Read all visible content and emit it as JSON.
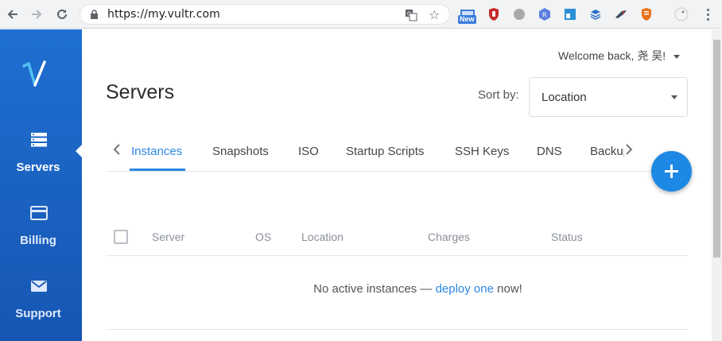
{
  "browser": {
    "url": "https://my.vultr.com",
    "extension_badge": "New",
    "icons": [
      "back-arrow-icon",
      "forward-arrow-icon",
      "reload-icon",
      "lock-icon",
      "translate-icon",
      "star-icon",
      "kebab-menu-icon"
    ]
  },
  "user": {
    "welcome": "Welcome back, 尧 吴!"
  },
  "sidebar": {
    "items": [
      {
        "label": "Servers",
        "icon": "server-stack-icon",
        "active": true
      },
      {
        "label": "Billing",
        "icon": "credit-card-icon",
        "active": false
      },
      {
        "label": "Support",
        "icon": "envelope-icon",
        "active": false
      }
    ]
  },
  "page": {
    "title": "Servers",
    "sort_label": "Sort by:",
    "sort_value": "Location"
  },
  "tabs": [
    {
      "label": "Instances",
      "active": true
    },
    {
      "label": "Snapshots",
      "active": false
    },
    {
      "label": "ISO",
      "active": false
    },
    {
      "label": "Startup Scripts",
      "active": false
    },
    {
      "label": "SSH Keys",
      "active": false
    },
    {
      "label": "DNS",
      "active": false
    },
    {
      "label": "Backups",
      "active": false
    }
  ],
  "table": {
    "columns": [
      "Server",
      "OS",
      "Location",
      "Charges",
      "Status"
    ],
    "empty": {
      "before": "No active instances — ",
      "link": "deploy one",
      "after": " now!"
    }
  },
  "colors": {
    "accent": "#2d87e3",
    "sidebar": "#1a63c4",
    "fab": "#1e88e5"
  }
}
